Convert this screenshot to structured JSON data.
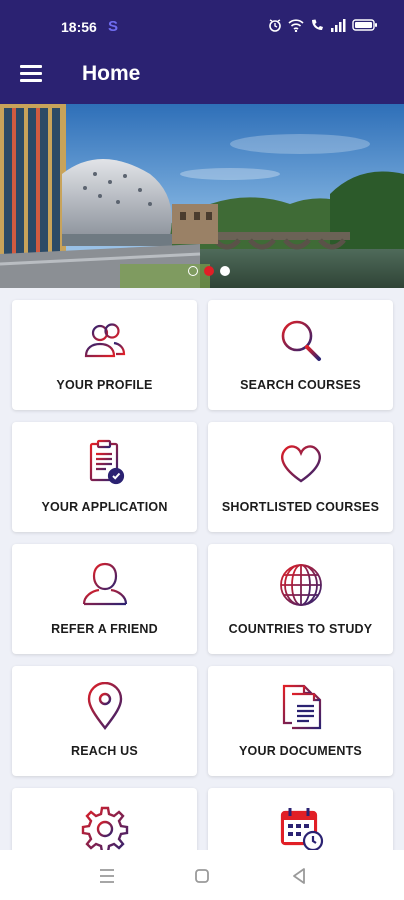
{
  "status_bar": {
    "time": "18:56",
    "app_indicator": "S",
    "icons": [
      "alarm-icon",
      "wifi-icon",
      "volte-call-icon",
      "signal-icon",
      "battery-icon"
    ]
  },
  "app_bar": {
    "title": "Home",
    "menu_icon": "hamburger-menu-icon"
  },
  "banner": {
    "slide_count": 3,
    "active_slide": 2
  },
  "tiles": [
    {
      "label": "YOUR PROFILE",
      "icon": "users-icon"
    },
    {
      "label": "SEARCH COURSES",
      "icon": "search-icon"
    },
    {
      "label": "YOUR APPLICATION",
      "icon": "clipboard-check-icon"
    },
    {
      "label": "SHORTLISTED COURSES",
      "icon": "heart-icon"
    },
    {
      "label": "REFER A FRIEND",
      "icon": "user-icon"
    },
    {
      "label": "COUNTRIES TO STUDY",
      "icon": "globe-icon"
    },
    {
      "label": "REACH US",
      "icon": "location-pin-icon"
    },
    {
      "label": "YOUR DOCUMENTS",
      "icon": "documents-icon"
    },
    {
      "label": "",
      "icon": "gear-icon"
    },
    {
      "label": "",
      "icon": "calendar-clock-icon"
    }
  ],
  "colors": {
    "primary": "#2b2272",
    "accent": "#e11f26",
    "icon_gradient_start": "#2b2272",
    "icon_gradient_end": "#e11f26"
  },
  "nav_bar": {
    "icons": [
      "recent-apps-icon",
      "home-icon",
      "back-icon"
    ]
  }
}
